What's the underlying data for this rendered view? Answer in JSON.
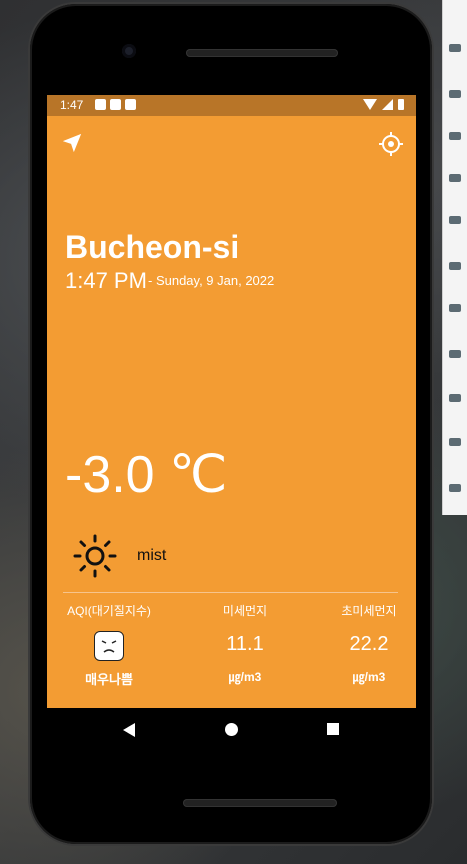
{
  "status_bar": {
    "time": "1:47"
  },
  "location": {
    "city": "Bucheon-si",
    "time": "1:47 PM",
    "date": "- Sunday, 9 Jan, 2022"
  },
  "weather": {
    "temperature": "-3.0 ℃",
    "condition": "mist",
    "icon": "sun-icon"
  },
  "air_quality": {
    "aqi": {
      "label": "AQI(대기질지수)",
      "status": "매우나쁨",
      "icon": "angry-face-icon"
    },
    "pm10": {
      "label": "미세먼지",
      "value": "11.1",
      "unit": "㎍/m3"
    },
    "pm25": {
      "label": "초미세먼지",
      "value": "22.2",
      "unit": "㎍/m3"
    }
  },
  "colors": {
    "background": "#F39C33",
    "status_bar": "#B87528",
    "text": "#FFFFFF"
  }
}
